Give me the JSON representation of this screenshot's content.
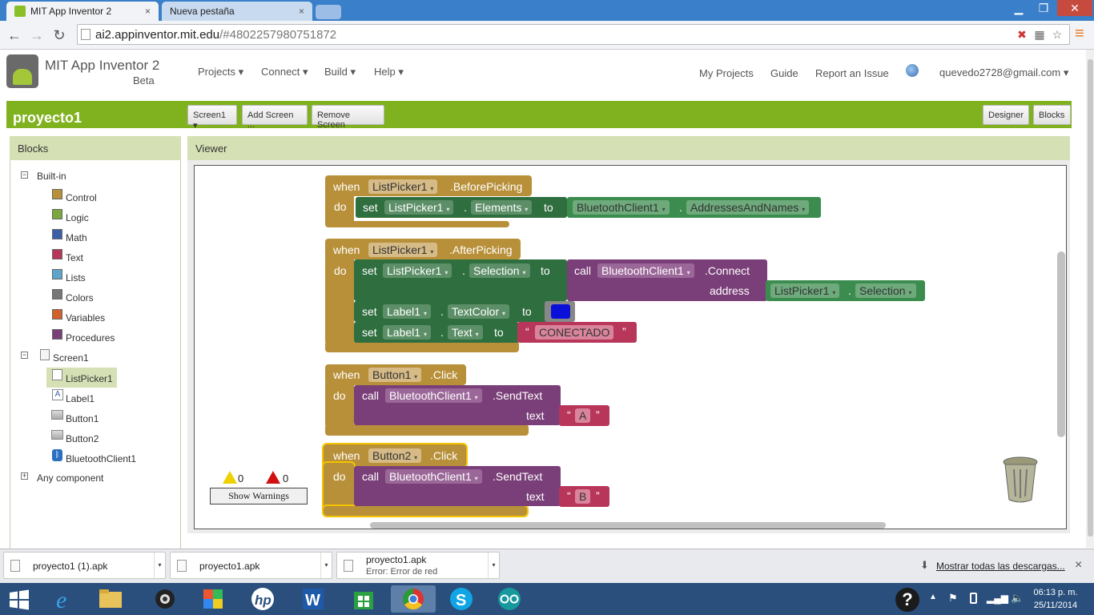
{
  "browser": {
    "tabs": [
      {
        "title": "MIT App Inventor 2",
        "close": "×"
      },
      {
        "title": "Nueva pestaña",
        "close": "×"
      }
    ],
    "window_buttons": {
      "minimize": "▁",
      "maximize": "❐",
      "close": "✕"
    },
    "nav": {
      "back": "←",
      "forward": "→",
      "reload": "↻"
    },
    "url_host": "ai2.appinventor.mit.edu",
    "url_path": "/#4802257980751872",
    "menu_icon": "≡"
  },
  "app": {
    "title": "MIT App Inventor 2",
    "subtitle": "Beta",
    "menus": [
      "Projects ▾",
      "Connect ▾",
      "Build ▾",
      "Help ▾"
    ],
    "right_links": [
      "My Projects",
      "Guide",
      "Report an Issue"
    ],
    "user": "quevedo2728@gmail.com ▾",
    "project_name": "proyecto1",
    "screen_select": "Screen1 ▾",
    "add_screen": "Add Screen ...",
    "remove_screen": "Remove Screen",
    "designer": "Designer",
    "blocks": "Blocks"
  },
  "blocks_panel": {
    "header": "Blocks",
    "builtin": "Built-in",
    "builtin_items": [
      {
        "label": "Control",
        "color": "#b8903a"
      },
      {
        "label": "Logic",
        "color": "#7aa83c"
      },
      {
        "label": "Math",
        "color": "#3d5fa8"
      },
      {
        "label": "Text",
        "color": "#b8365a"
      },
      {
        "label": "Lists",
        "color": "#5ba6c9"
      },
      {
        "label": "Colors",
        "color": "#777777"
      },
      {
        "label": "Variables",
        "color": "#d2602a"
      },
      {
        "label": "Procedures",
        "color": "#7a3f78"
      }
    ],
    "screen": "Screen1",
    "components": [
      "ListPicker1",
      "Label1",
      "Button1",
      "Button2",
      "BluetoothClient1"
    ],
    "any_component": "Any component"
  },
  "viewer": {
    "header": "Viewer",
    "warnings_count": "0",
    "errors_count": "0",
    "show_warnings": "Show Warnings"
  },
  "code": {
    "when": "when",
    "do": "do",
    "set": "set",
    "to": "to",
    "call": "call",
    "dot": ".",
    "b1": {
      "component": "ListPicker1",
      "event": ".BeforePicking",
      "set_comp": "ListPicker1",
      "set_prop": "Elements",
      "get_comp": "BluetoothClient1",
      "get_prop": "AddressesAndNames"
    },
    "b2": {
      "component": "ListPicker1",
      "event": ".AfterPicking",
      "set1_comp": "ListPicker1",
      "set1_prop": "Selection",
      "call_comp": "BluetoothClient1",
      "call_method": ".Connect",
      "address": "address",
      "arg_comp": "ListPicker1",
      "arg_prop": "Selection",
      "set2_comp": "Label1",
      "set2_prop": "TextColor",
      "color_value": "#0a10d8",
      "set3_comp": "Label1",
      "set3_prop": "Text",
      "str_value": "CONECTADO"
    },
    "b3": {
      "component": "Button1",
      "event": ".Click",
      "call_comp": "BluetoothClient1",
      "call_method": ".SendText",
      "text": "text",
      "str_value": "A"
    },
    "b4": {
      "component": "Button2",
      "event": ".Click",
      "call_comp": "BluetoothClient1",
      "call_method": ".SendText",
      "text": "text",
      "str_value": "B"
    }
  },
  "downloads": {
    "items": [
      {
        "name": "proyecto1 (1).apk",
        "status": ""
      },
      {
        "name": "proyecto1.apk",
        "status": ""
      },
      {
        "name": "proyecto1.apk",
        "status": "Error: Error de red"
      }
    ],
    "show_all": "Mostrar todas las descargas...",
    "close": "×"
  },
  "taskbar": {
    "time": "06:13 p. m.",
    "date": "25/11/2014",
    "help": "?"
  }
}
